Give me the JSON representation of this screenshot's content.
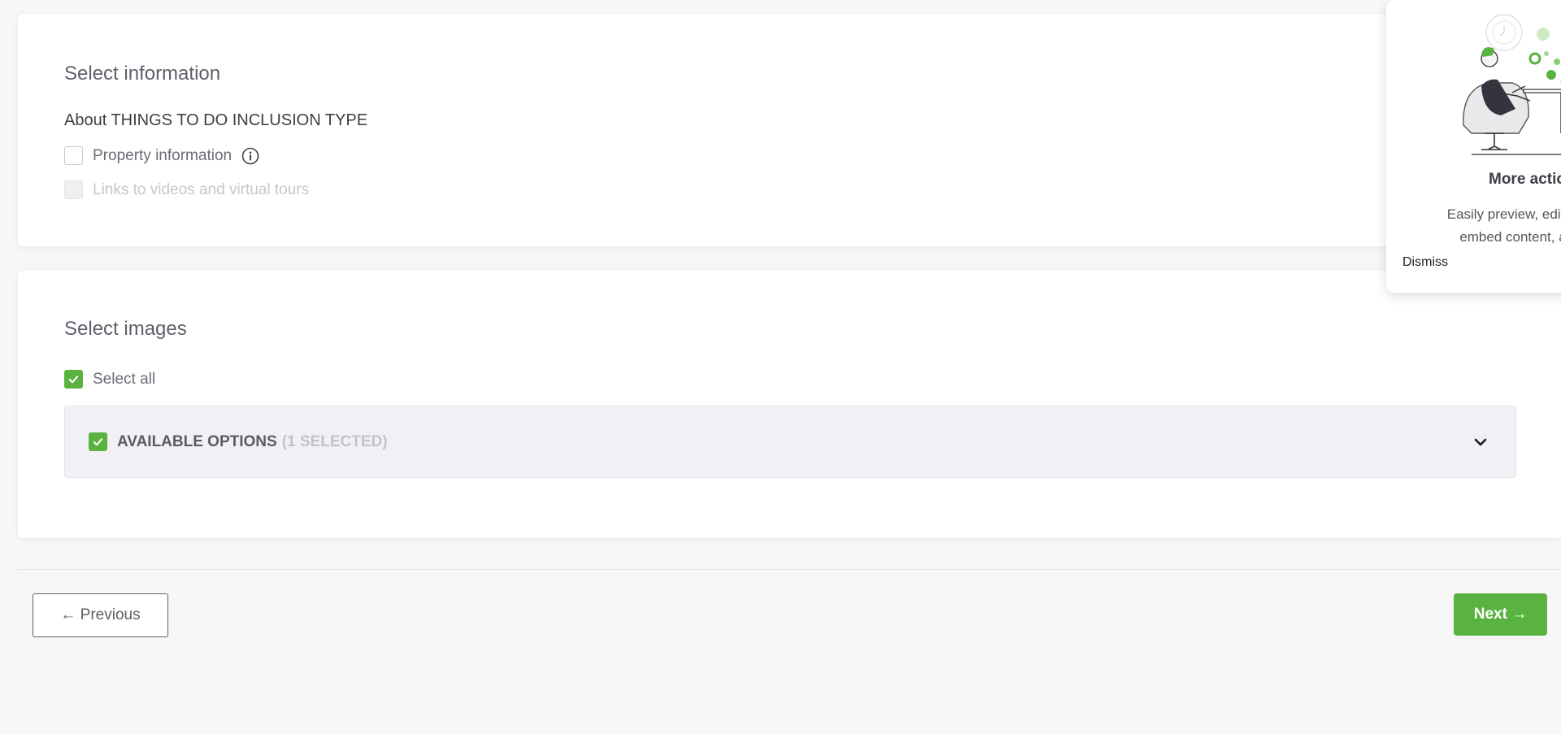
{
  "select_information": {
    "title": "Select information",
    "subheading": "About THINGS TO DO INCLUSION TYPE",
    "options": [
      {
        "label": "Property information",
        "checked": false,
        "disabled": false
      },
      {
        "label": "Links to videos and virtual tours",
        "checked": false,
        "disabled": true
      }
    ]
  },
  "select_images": {
    "title": "Select images",
    "select_all_label": "Select all",
    "select_all_checked": true,
    "panel": {
      "label": "AVAILABLE OPTIONS",
      "count_text": "(1 SELECTED)",
      "checked": true
    }
  },
  "navigation": {
    "previous_label": "← Previous",
    "next_label": "Next →"
  },
  "popover": {
    "title": "More actio",
    "text_line1": "Easily preview, edit, c",
    "text_line2": "embed content, a",
    "dismiss_label": "Dismiss"
  },
  "colors": {
    "accent": "#5ab240",
    "background": "#f7f7f7",
    "panel": "#f1f1f5"
  },
  "icons": {
    "info": "info-circle-icon",
    "check": "checkmark-icon",
    "chevron": "chevron-down-icon"
  }
}
